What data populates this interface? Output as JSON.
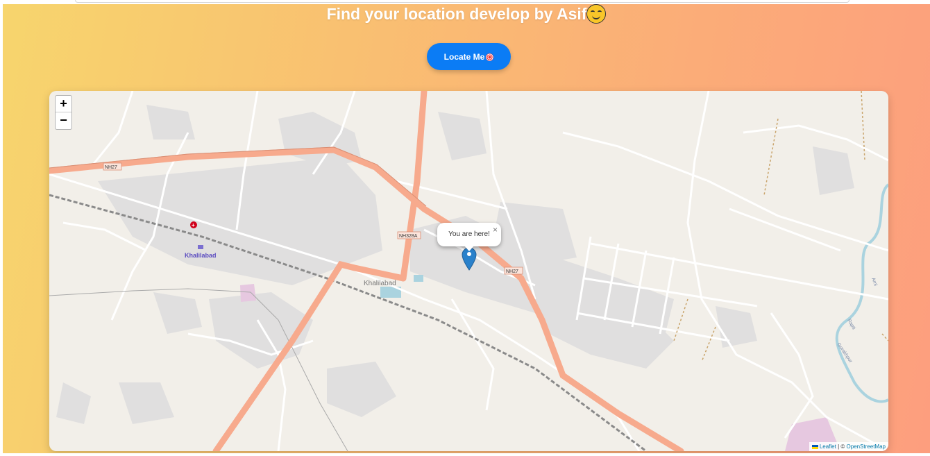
{
  "header": {
    "title": "Find your location develop by Asif",
    "title_emoji": "smiling-face-icon"
  },
  "locate_button": {
    "label": "Locate Me",
    "icon": "target-icon"
  },
  "map": {
    "zoom_in_label": "+",
    "zoom_out_label": "−",
    "popup_text": "You are here!",
    "popup_close": "×",
    "marker_icon": "map-pin-icon",
    "place_labels": {
      "khalilabad_station": "Khalilabad",
      "khalilabad_town": "Khalilabad",
      "river_1": "Ami",
      "river_2": "Rapti",
      "river_3": "Gorakhpur"
    },
    "road_shields": {
      "nh27_west": "NH27",
      "nh328a": "NH328A",
      "nh27_east": "NH27"
    },
    "attribution": {
      "leaflet": "Leaflet",
      "separator": "| ©",
      "osm": "OpenStreetMap"
    }
  },
  "colors": {
    "gradient_start": "#f7d56d",
    "gradient_end": "#fd9e7e",
    "button": "#0b7cf5",
    "map_background": "#f2efe9",
    "highway": "#f7aa8d",
    "water": "#aad3df",
    "marker": "#2a81cb"
  }
}
